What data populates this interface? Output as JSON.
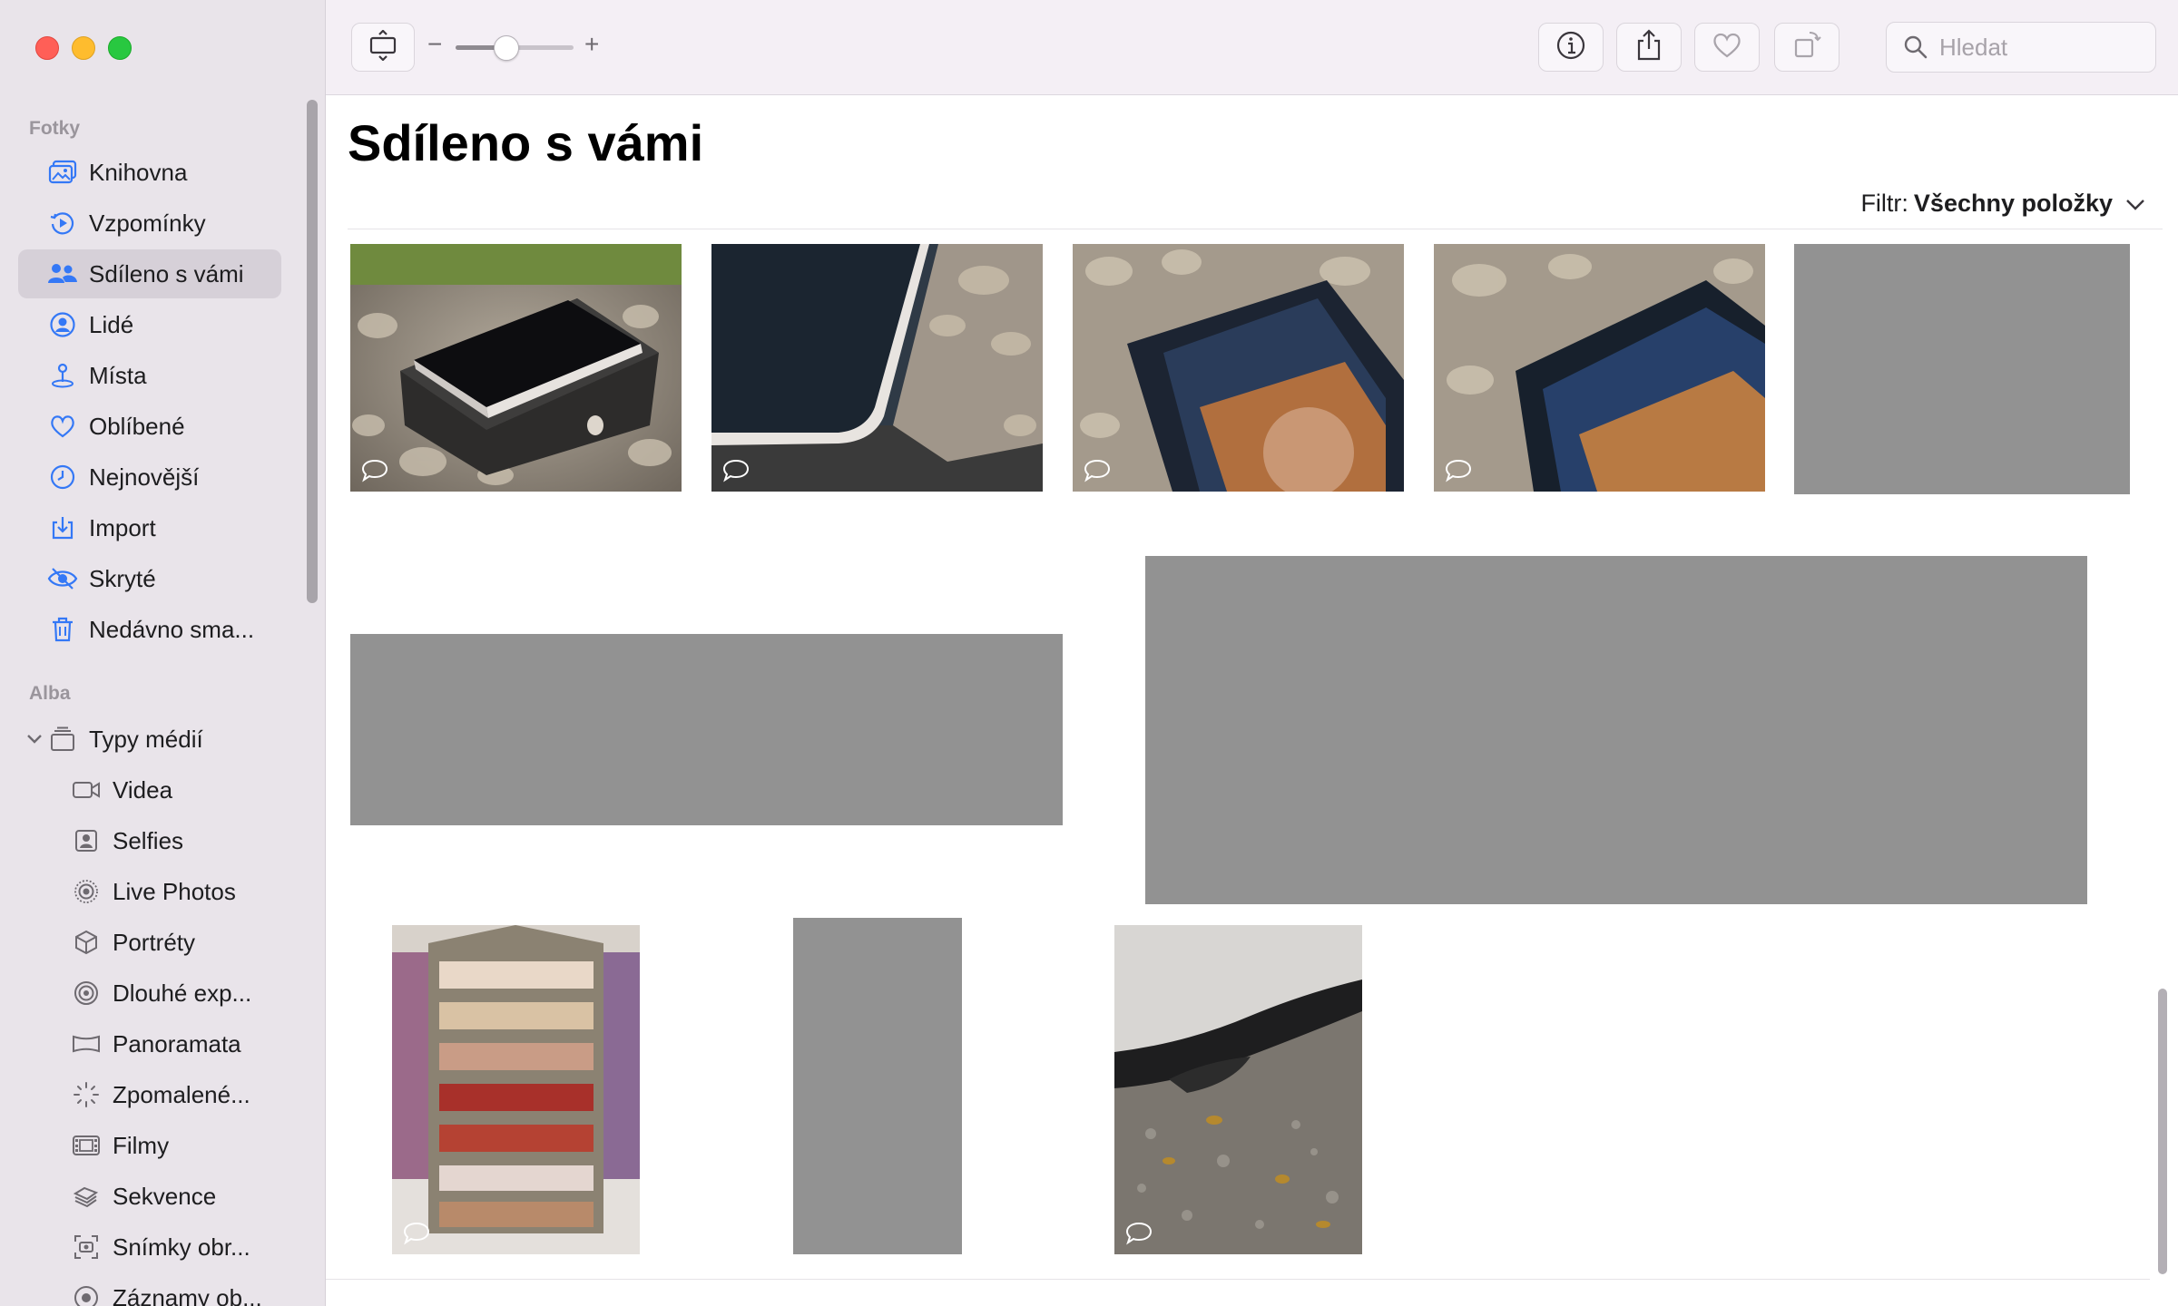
{
  "sidebar": {
    "section_photos": "Fotky",
    "items": [
      {
        "label": "Knihovna",
        "icon": "library-icon"
      },
      {
        "label": "Vzpomínky",
        "icon": "memories-icon"
      },
      {
        "label": "Sdíleno s vámi",
        "icon": "shared-with-you-icon",
        "selected": true
      },
      {
        "label": "Lidé",
        "icon": "people-icon"
      },
      {
        "label": "Místa",
        "icon": "places-icon"
      },
      {
        "label": "Oblíbené",
        "icon": "heart-icon"
      },
      {
        "label": "Nejnovější",
        "icon": "clock-icon"
      },
      {
        "label": "Import",
        "icon": "import-icon"
      },
      {
        "label": "Skryté",
        "icon": "hidden-eye-icon"
      },
      {
        "label": "Nedávno sma...",
        "icon": "trash-icon"
      }
    ],
    "section_albums": "Alba",
    "media_types_label": "Typy médií",
    "media_types": [
      {
        "label": "Videa",
        "icon": "video-icon"
      },
      {
        "label": "Selfies",
        "icon": "selfie-icon"
      },
      {
        "label": "Live Photos",
        "icon": "live-photo-icon"
      },
      {
        "label": "Portréty",
        "icon": "portrait-cube-icon"
      },
      {
        "label": "Dlouhé exp...",
        "icon": "long-exposure-icon"
      },
      {
        "label": "Panoramata",
        "icon": "panorama-icon"
      },
      {
        "label": "Zpomalené...",
        "icon": "slow-motion-icon"
      },
      {
        "label": "Filmy",
        "icon": "film-icon"
      },
      {
        "label": "Sekvence",
        "icon": "burst-icon"
      },
      {
        "label": "Snímky obr...",
        "icon": "screenshot-icon"
      },
      {
        "label": "Záznamy ob...",
        "icon": "screen-recording-icon"
      }
    ]
  },
  "toolbar": {
    "zoom_minus": "−",
    "zoom_plus": "+",
    "zoom_level": 0.42,
    "search_placeholder": "Hledat"
  },
  "main": {
    "title": "Sdíleno s vámi",
    "filter_label": "Filtr:",
    "filter_value": "Všechny položky"
  },
  "photos": [
    {
      "name": "photo-iphone-box-1",
      "kind": "iphone-box",
      "comment": true
    },
    {
      "name": "photo-iphone-box-2",
      "kind": "iphone-edge",
      "comment": true
    },
    {
      "name": "photo-iphone-screen-1",
      "kind": "iphone-screen",
      "comment": true
    },
    {
      "name": "photo-iphone-screen-2",
      "kind": "iphone-screen",
      "comment": true
    },
    {
      "name": "photo-redacted-1",
      "kind": "redacted"
    },
    {
      "name": "photo-redacted-2",
      "kind": "redacted"
    },
    {
      "name": "photo-redacted-3",
      "kind": "redacted"
    },
    {
      "name": "photo-ribbon-shelf",
      "kind": "shelf",
      "comment": true
    },
    {
      "name": "photo-redacted-4",
      "kind": "redacted"
    },
    {
      "name": "photo-car-gravel",
      "kind": "car",
      "comment": true
    }
  ],
  "colors": {
    "sidebar_bg": "#e9e4ea",
    "selected_bg": "#d6d0d8",
    "accent_icon": "#3478f6",
    "redacted": "#929292"
  }
}
